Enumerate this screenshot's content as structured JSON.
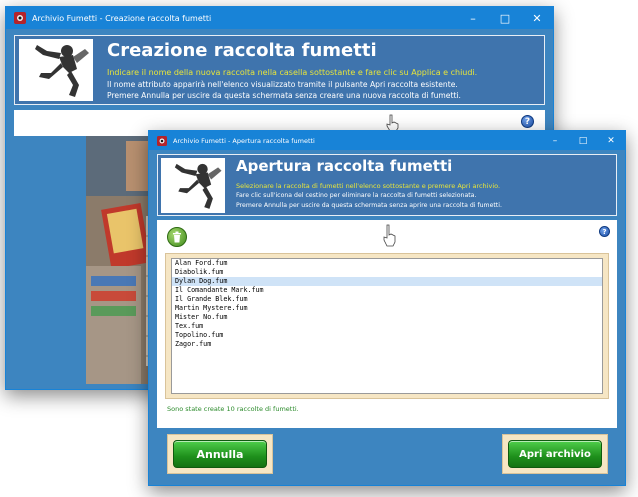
{
  "back_window": {
    "title": "Archivio Fumetti - Creazione raccolta fumetti",
    "header": {
      "title": "Creazione raccolta fumetti",
      "instruction": "Indicare il nome della nuova raccolta nella casella sottostante e fare clic su Applica e chiudi.",
      "line2": "Il nome attributo apparirà nell'elenco visualizzato tramite il pulsante Apri raccolta esistente.",
      "line3": "Premere Annulla per uscire da questa schermata senza creare una nuova raccolta di fumetti."
    }
  },
  "front_window": {
    "title": "Archivio Fumetti - Apertura raccolta fumetti",
    "header": {
      "title": "Apertura raccolta fumetti",
      "instruction": "Selezionare la raccolta di fumetti nell'elenco sottostante e premere Apri archivio.",
      "line2": "Fare clic sull'icona del cestino per eliminare la raccolta di fumetti selezionata.",
      "line3": "Premere Annulla per uscire da questa schermata senza aprire una raccolta di fumetti."
    },
    "files": [
      "Alan Ford.fum",
      "Diabolik.fum",
      "Dylan Dog.fum",
      "Il Comandante Mark.fum",
      "Il Grande Blek.fum",
      "Martin Mystere.fum",
      "Mister No.fum",
      "Tex.fum",
      "Topolino.fum",
      "Zagor.fum"
    ],
    "selected_index": 2,
    "status": "Sono state create 10 raccolte di fumetti.",
    "cancel_label": "Annulla",
    "open_label": "Apri archivio"
  },
  "colors": {
    "titlebar": "#1883d7",
    "frame": "#3d85c0",
    "header": "#3f74ad",
    "instruction": "#e8e53a",
    "status": "#2a8a2a",
    "selection": "#cfe3f7"
  },
  "icons": {
    "help": "help-icon",
    "trash": "trash-icon",
    "pointer": "hand-pointer-icon",
    "app": "app-icon"
  }
}
